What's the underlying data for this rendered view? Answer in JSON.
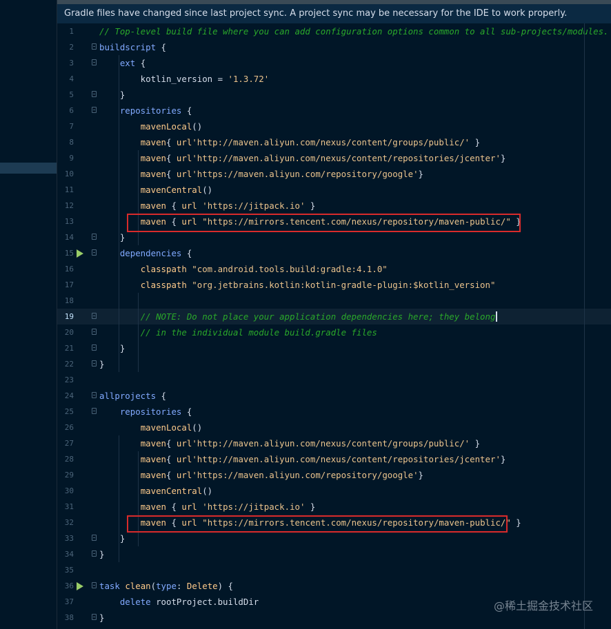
{
  "banner": {
    "message": "Gradle files have changed since last project sync. A project sync may be necessary for the IDE to work properly."
  },
  "editor": {
    "current_line": 19,
    "lines": [
      {
        "n": "1",
        "fold": false,
        "run": false,
        "tokens": [
          {
            "t": "// Top-level build file where you can add configuration options common to all sub-projects/modules.",
            "c": "comment"
          }
        ]
      },
      {
        "n": "2",
        "fold": true,
        "run": false,
        "tokens": [
          {
            "t": "buildscript",
            "c": "kw"
          },
          {
            "t": " {",
            "c": "plain"
          }
        ]
      },
      {
        "n": "3",
        "fold": true,
        "run": false,
        "tokens": [
          {
            "t": "    ",
            "c": "plain"
          },
          {
            "t": "ext",
            "c": "kw"
          },
          {
            "t": " {",
            "c": "plain"
          }
        ]
      },
      {
        "n": "4",
        "fold": false,
        "run": false,
        "tokens": [
          {
            "t": "        kotlin_version = ",
            "c": "plain"
          },
          {
            "t": "'1.3.72'",
            "c": "str"
          }
        ]
      },
      {
        "n": "5",
        "fold": true,
        "run": false,
        "tokens": [
          {
            "t": "    }",
            "c": "plain"
          }
        ]
      },
      {
        "n": "6",
        "fold": true,
        "run": false,
        "tokens": [
          {
            "t": "    ",
            "c": "plain"
          },
          {
            "t": "repositories",
            "c": "kw"
          },
          {
            "t": " {",
            "c": "plain"
          }
        ]
      },
      {
        "n": "7",
        "fold": false,
        "run": false,
        "tokens": [
          {
            "t": "        ",
            "c": "plain"
          },
          {
            "t": "mavenLocal",
            "c": "fn"
          },
          {
            "t": "()",
            "c": "plain"
          }
        ]
      },
      {
        "n": "8",
        "fold": false,
        "run": false,
        "tokens": [
          {
            "t": "        ",
            "c": "plain"
          },
          {
            "t": "maven",
            "c": "fn"
          },
          {
            "t": "{ ",
            "c": "plain"
          },
          {
            "t": "url",
            "c": "fn"
          },
          {
            "t": "'http://maven.aliyun.com/nexus/content/groups/public/'",
            "c": "str"
          },
          {
            "t": " }",
            "c": "plain"
          }
        ]
      },
      {
        "n": "9",
        "fold": false,
        "run": false,
        "tokens": [
          {
            "t": "        ",
            "c": "plain"
          },
          {
            "t": "maven",
            "c": "fn"
          },
          {
            "t": "{ ",
            "c": "plain"
          },
          {
            "t": "url",
            "c": "fn"
          },
          {
            "t": "'http://maven.aliyun.com/nexus/content/repositories/jcenter'",
            "c": "str"
          },
          {
            "t": "}",
            "c": "plain"
          }
        ]
      },
      {
        "n": "10",
        "fold": false,
        "run": false,
        "tokens": [
          {
            "t": "        ",
            "c": "plain"
          },
          {
            "t": "maven",
            "c": "fn"
          },
          {
            "t": "{ ",
            "c": "plain"
          },
          {
            "t": "url",
            "c": "fn"
          },
          {
            "t": "'https://maven.aliyun.com/repository/google'",
            "c": "str"
          },
          {
            "t": "}",
            "c": "plain"
          }
        ]
      },
      {
        "n": "11",
        "fold": false,
        "run": false,
        "tokens": [
          {
            "t": "        ",
            "c": "plain"
          },
          {
            "t": "mavenCentral",
            "c": "fn"
          },
          {
            "t": "()",
            "c": "plain"
          }
        ]
      },
      {
        "n": "12",
        "fold": false,
        "run": false,
        "tokens": [
          {
            "t": "        ",
            "c": "plain"
          },
          {
            "t": "maven",
            "c": "fn"
          },
          {
            "t": " { ",
            "c": "plain"
          },
          {
            "t": "url",
            "c": "fn"
          },
          {
            "t": " ",
            "c": "plain"
          },
          {
            "t": "'https://jitpack.io'",
            "c": "str"
          },
          {
            "t": " }",
            "c": "plain"
          }
        ]
      },
      {
        "n": "13",
        "fold": false,
        "run": false,
        "tokens": [
          {
            "t": "        ",
            "c": "plain"
          },
          {
            "t": "maven",
            "c": "fn"
          },
          {
            "t": " { ",
            "c": "plain"
          },
          {
            "t": "url",
            "c": "fn"
          },
          {
            "t": " ",
            "c": "plain"
          },
          {
            "t": "\"https://mirrors.tencent.com/nexus/repository/maven-public/\"",
            "c": "str"
          },
          {
            "t": " }",
            "c": "plain"
          }
        ]
      },
      {
        "n": "14",
        "fold": true,
        "run": false,
        "tokens": [
          {
            "t": "    }",
            "c": "plain"
          }
        ]
      },
      {
        "n": "15",
        "fold": true,
        "run": true,
        "tokens": [
          {
            "t": "    ",
            "c": "plain"
          },
          {
            "t": "dependencies",
            "c": "kw"
          },
          {
            "t": " {",
            "c": "plain"
          }
        ]
      },
      {
        "n": "16",
        "fold": false,
        "run": false,
        "tokens": [
          {
            "t": "        ",
            "c": "plain"
          },
          {
            "t": "classpath",
            "c": "fn"
          },
          {
            "t": " ",
            "c": "plain"
          },
          {
            "t": "\"com.android.tools.build:gradle:4.1.0\"",
            "c": "str"
          }
        ]
      },
      {
        "n": "17",
        "fold": false,
        "run": false,
        "tokens": [
          {
            "t": "        ",
            "c": "plain"
          },
          {
            "t": "classpath",
            "c": "fn"
          },
          {
            "t": " ",
            "c": "plain"
          },
          {
            "t": "\"org.jetbrains.kotlin:kotlin-gradle-plugin:$kotlin_version\"",
            "c": "str"
          }
        ]
      },
      {
        "n": "18",
        "fold": false,
        "run": false,
        "tokens": []
      },
      {
        "n": "19",
        "fold": true,
        "run": false,
        "tokens": [
          {
            "t": "        ",
            "c": "plain"
          },
          {
            "t": "// NOTE: Do not place your application dependencies here; they belong",
            "c": "comment"
          }
        ]
      },
      {
        "n": "20",
        "fold": true,
        "run": false,
        "tokens": [
          {
            "t": "        ",
            "c": "plain"
          },
          {
            "t": "// in the individual module build.gradle files",
            "c": "comment"
          }
        ]
      },
      {
        "n": "21",
        "fold": true,
        "run": false,
        "tokens": [
          {
            "t": "    }",
            "c": "plain"
          }
        ]
      },
      {
        "n": "22",
        "fold": true,
        "run": false,
        "tokens": [
          {
            "t": "}",
            "c": "plain"
          }
        ]
      },
      {
        "n": "23",
        "fold": false,
        "run": false,
        "tokens": []
      },
      {
        "n": "24",
        "fold": true,
        "run": false,
        "tokens": [
          {
            "t": "allprojects",
            "c": "kw"
          },
          {
            "t": " {",
            "c": "plain"
          }
        ]
      },
      {
        "n": "25",
        "fold": true,
        "run": false,
        "tokens": [
          {
            "t": "    ",
            "c": "plain"
          },
          {
            "t": "repositories",
            "c": "kw"
          },
          {
            "t": " {",
            "c": "plain"
          }
        ]
      },
      {
        "n": "26",
        "fold": false,
        "run": false,
        "tokens": [
          {
            "t": "        ",
            "c": "plain"
          },
          {
            "t": "mavenLocal",
            "c": "fn"
          },
          {
            "t": "()",
            "c": "plain"
          }
        ]
      },
      {
        "n": "27",
        "fold": false,
        "run": false,
        "tokens": [
          {
            "t": "        ",
            "c": "plain"
          },
          {
            "t": "maven",
            "c": "fn"
          },
          {
            "t": "{ ",
            "c": "plain"
          },
          {
            "t": "url",
            "c": "fn"
          },
          {
            "t": "'http://maven.aliyun.com/nexus/content/groups/public/'",
            "c": "str"
          },
          {
            "t": " }",
            "c": "plain"
          }
        ]
      },
      {
        "n": "28",
        "fold": false,
        "run": false,
        "tokens": [
          {
            "t": "        ",
            "c": "plain"
          },
          {
            "t": "maven",
            "c": "fn"
          },
          {
            "t": "{ ",
            "c": "plain"
          },
          {
            "t": "url",
            "c": "fn"
          },
          {
            "t": "'http://maven.aliyun.com/nexus/content/repositories/jcenter'",
            "c": "str"
          },
          {
            "t": "}",
            "c": "plain"
          }
        ]
      },
      {
        "n": "29",
        "fold": false,
        "run": false,
        "tokens": [
          {
            "t": "        ",
            "c": "plain"
          },
          {
            "t": "maven",
            "c": "fn"
          },
          {
            "t": "{ ",
            "c": "plain"
          },
          {
            "t": "url",
            "c": "fn"
          },
          {
            "t": "'https://maven.aliyun.com/repository/google'",
            "c": "str"
          },
          {
            "t": "}",
            "c": "plain"
          }
        ]
      },
      {
        "n": "30",
        "fold": false,
        "run": false,
        "tokens": [
          {
            "t": "        ",
            "c": "plain"
          },
          {
            "t": "mavenCentral",
            "c": "fn"
          },
          {
            "t": "()",
            "c": "plain"
          }
        ]
      },
      {
        "n": "31",
        "fold": false,
        "run": false,
        "tokens": [
          {
            "t": "        ",
            "c": "plain"
          },
          {
            "t": "maven",
            "c": "fn"
          },
          {
            "t": " { ",
            "c": "plain"
          },
          {
            "t": "url",
            "c": "fn"
          },
          {
            "t": " ",
            "c": "plain"
          },
          {
            "t": "'https://jitpack.io'",
            "c": "str"
          },
          {
            "t": " }",
            "c": "plain"
          }
        ]
      },
      {
        "n": "32",
        "fold": false,
        "run": false,
        "tokens": [
          {
            "t": "        ",
            "c": "plain"
          },
          {
            "t": "maven",
            "c": "fn"
          },
          {
            "t": " { ",
            "c": "plain"
          },
          {
            "t": "url",
            "c": "fn"
          },
          {
            "t": " ",
            "c": "plain"
          },
          {
            "t": "\"https://mirrors.tencent.com/nexus/repository/maven-public/\"",
            "c": "str"
          },
          {
            "t": " }",
            "c": "plain"
          }
        ]
      },
      {
        "n": "33",
        "fold": true,
        "run": false,
        "tokens": [
          {
            "t": "    }",
            "c": "plain"
          }
        ]
      },
      {
        "n": "34",
        "fold": true,
        "run": false,
        "tokens": [
          {
            "t": "}",
            "c": "plain"
          }
        ]
      },
      {
        "n": "35",
        "fold": false,
        "run": false,
        "tokens": []
      },
      {
        "n": "36",
        "fold": true,
        "run": true,
        "tokens": [
          {
            "t": "task",
            "c": "kw"
          },
          {
            "t": " ",
            "c": "plain"
          },
          {
            "t": "clean",
            "c": "fn"
          },
          {
            "t": "(",
            "c": "plain"
          },
          {
            "t": "type",
            "c": "kw"
          },
          {
            "t": ": ",
            "c": "plain"
          },
          {
            "t": "Delete",
            "c": "fn"
          },
          {
            "t": ") {",
            "c": "plain"
          }
        ]
      },
      {
        "n": "37",
        "fold": false,
        "run": false,
        "tokens": [
          {
            "t": "    ",
            "c": "plain"
          },
          {
            "t": "delete",
            "c": "kw"
          },
          {
            "t": " rootProject.buildDir",
            "c": "plain"
          }
        ]
      },
      {
        "n": "38",
        "fold": true,
        "run": false,
        "tokens": [
          {
            "t": "}",
            "c": "plain"
          }
        ]
      }
    ]
  },
  "highlighted_lines": [
    "13",
    "32"
  ],
  "watermark": "@稀土掘金技术社区"
}
